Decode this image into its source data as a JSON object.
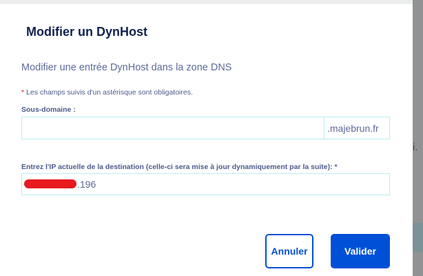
{
  "background": {
    "partial_text": "i."
  },
  "modal": {
    "title": "Modifier un DynHost",
    "subtitle": "Modifier une entrée DynHost dans la zone DNS",
    "required_note_star": "*",
    "required_note": " Les champs suivis d'un astérisque sont obligatoires.",
    "subdomain": {
      "label": "Sous-domaine :",
      "value": "",
      "suffix": ".majebrun.fr"
    },
    "ip": {
      "label": "Entrez l'IP actuelle de la destination (celle-ci sera mise à jour dynamiquement par la suite):  *",
      "value": ".196"
    },
    "cancel_label": "Annuler",
    "submit_label": "Valider"
  },
  "colors": {
    "primary": "#0050d7",
    "title": "#122150",
    "border": "#b7eef3"
  }
}
